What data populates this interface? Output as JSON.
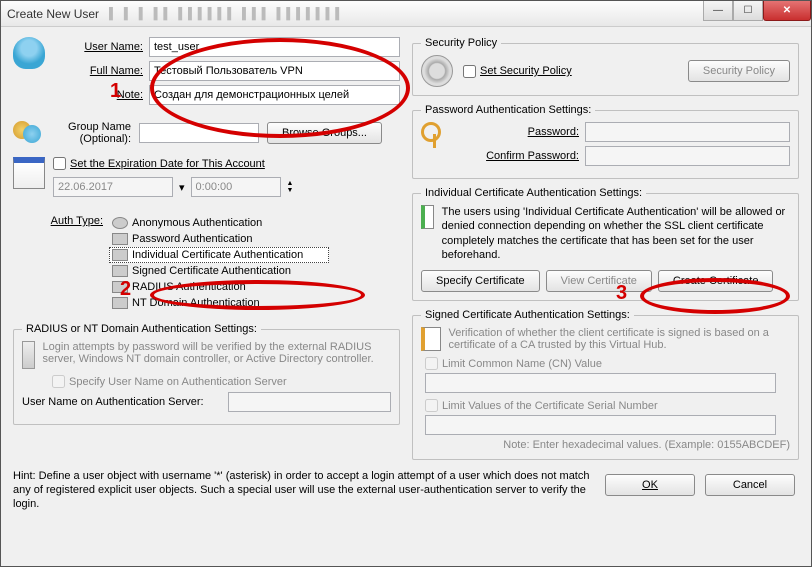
{
  "window": {
    "title": "Create New User"
  },
  "user": {
    "username_label": "User Name:",
    "username_value": "test_user",
    "fullname_label": "Full Name:",
    "fullname_value": "Тестовый Пользователь VPN",
    "note_label": "Note:",
    "note_value": "Создан для демонстрационных целей"
  },
  "group": {
    "label": "Group Name (Optional):",
    "value": "",
    "browse": "Browse Groups..."
  },
  "expire": {
    "set_label": "Set the Expiration Date for This Account",
    "date": "22.06.2017",
    "time": "0:00:00"
  },
  "auth": {
    "type_label": "Auth Type:",
    "items": [
      "Anonymous Authentication",
      "Password Authentication",
      "Individual Certificate Authentication",
      "Signed Certificate Authentication",
      "RADIUS Authentication",
      "NT Domain Authentication"
    ],
    "selected_index": 2
  },
  "radius": {
    "legend": "RADIUS or NT Domain Authentication Settings:",
    "desc": "Login attempts by password will be verified by the external RADIUS server, Windows NT domain controller, or Active Directory controller.",
    "specify_cb": "Specify User Name on Authentication Server",
    "username_label": "User Name on Authentication Server:"
  },
  "security": {
    "legend": "Security Policy",
    "set_cb": "Set Security Policy",
    "btn": "Security Policy"
  },
  "password": {
    "legend": "Password Authentication Settings:",
    "pw_label": "Password:",
    "cpw_label": "Confirm Password:"
  },
  "indiv": {
    "legend": "Individual Certificate Authentication Settings:",
    "desc": "The users using 'Individual Certificate Authentication' will be allowed or denied connection depending on whether the SSL client certificate completely matches the certificate that has been set for the user beforehand.",
    "specify": "Specify Certificate",
    "view": "View Certificate",
    "create": "Create Certificate"
  },
  "signed": {
    "legend": "Signed Certificate Authentication Settings:",
    "desc": "Verification of whether the client certificate is signed is based on a certificate of a CA trusted by this Virtual Hub.",
    "limit_cn": "Limit Common Name (CN) Value",
    "limit_serial": "Limit Values of the Certificate Serial Number",
    "note": "Note: Enter hexadecimal values. (Example: 0155ABCDEF)"
  },
  "hint": "Hint: Define a user object with username '*' (asterisk) in order to accept a login attempt of a user which does not match any of registered explicit user objects. Such a special user will use the external user-authentication server to verify the login.",
  "buttons": {
    "ok": "OK",
    "cancel": "Cancel"
  },
  "annotations": {
    "n1": "1",
    "n2": "2",
    "n3": "3"
  }
}
